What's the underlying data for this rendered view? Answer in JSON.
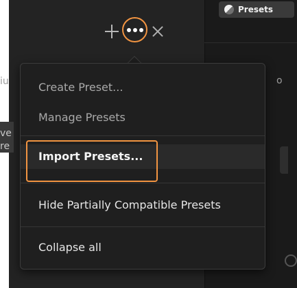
{
  "header": {
    "presets_tab_label": "Presets",
    "add_icon": "plus-icon",
    "more_icon": "more-options-icon",
    "close_icon": "close-icon",
    "accent_color": "#f39542"
  },
  "menu": {
    "items": [
      {
        "label": "Create Preset..."
      },
      {
        "label": "Manage Presets"
      },
      {
        "label": "Import Presets..."
      },
      {
        "label": "Hide Partially Compatible Presets"
      },
      {
        "label": "Collapse all"
      }
    ]
  },
  "background": {
    "left_text_1": "iu",
    "left_text_2": "ve",
    "left_text_3": "re",
    "right_text_1": "o"
  }
}
